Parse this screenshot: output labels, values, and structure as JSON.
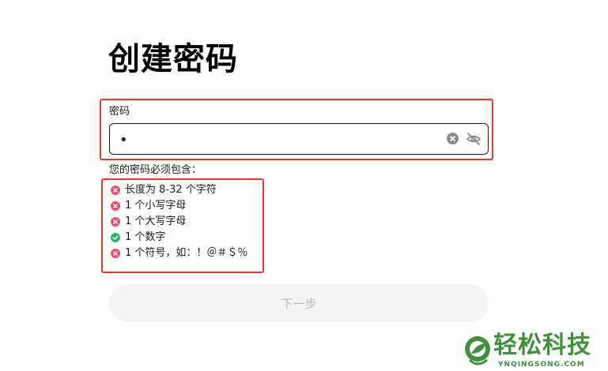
{
  "page": {
    "title": "创建密码"
  },
  "password_field": {
    "label": "密码",
    "value": "•"
  },
  "requirements": {
    "heading": "您的密码必须包含：",
    "items": [
      {
        "label": "长度为 8-32 个字符",
        "met": false
      },
      {
        "label": "1 个小写字母",
        "met": false
      },
      {
        "label": "1 个大写字母",
        "met": false
      },
      {
        "label": "1 个数字",
        "met": true
      },
      {
        "label": "1 个符号，如：！＠＃＄％",
        "met": false
      }
    ]
  },
  "next_button": {
    "label": "下一步"
  },
  "watermark": {
    "name": "轻松科技",
    "url": "YNQINGSONG.COM"
  },
  "colors": {
    "unmet": "#e0546a",
    "met": "#2fb55a",
    "highlight": "#e03a2e"
  }
}
